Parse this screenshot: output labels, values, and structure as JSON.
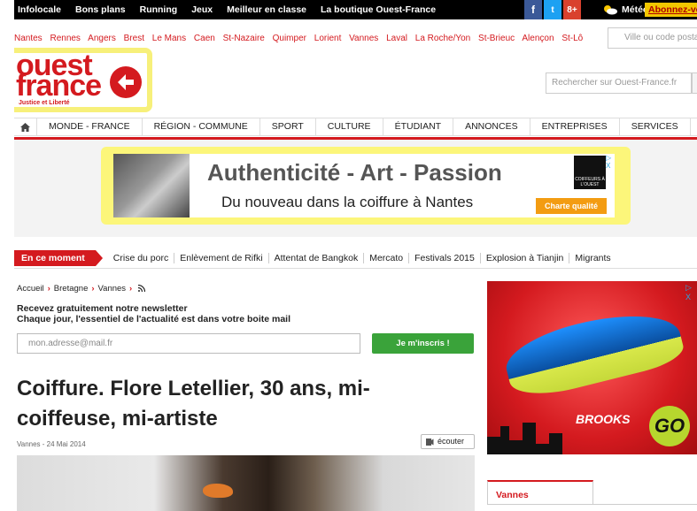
{
  "topbar": {
    "links": [
      "Infolocale",
      "Bons plans",
      "Running",
      "Jeux",
      "Meilleur en classe",
      "La boutique Ouest-France"
    ],
    "social": [
      "f",
      "t",
      "8+"
    ],
    "meteo": "Météo",
    "subscribe": "Abonnez-vous"
  },
  "cities": [
    "Nantes",
    "Rennes",
    "Angers",
    "Brest",
    "Le Mans",
    "Caen",
    "St-Nazaire",
    "Quimper",
    "Lorient",
    "Vannes",
    "Laval",
    "La Roche/Yon",
    "St-Brieuc",
    "Alençon",
    "St-Lô"
  ],
  "city_search_placeholder": "Ville ou code postal",
  "logo": {
    "line1": "ouest",
    "line2": "france",
    "tagline": "Justice et Liberté"
  },
  "site_search_placeholder": "Rechercher sur Ouest-France.fr",
  "nav": [
    "MONDE - FRANCE",
    "RÉGION - COMMUNE",
    "SPORT",
    "CULTURE",
    "ÉTUDIANT",
    "ANNONCES",
    "ENTREPRISES",
    "SERVICES"
  ],
  "ad_banner": {
    "headline": "Authenticité - Art - Passion",
    "subline": "Du nouveau dans la coiffure à Nantes",
    "badge": "COIFFEURS À L'OUEST",
    "button": "Charte qualité",
    "close_label": "▷ X"
  },
  "en_ce_moment": {
    "label": "En ce moment",
    "topics": [
      "Crise du porc",
      "Enlèvement de Rifki",
      "Attentat de Bangkok",
      "Mercato",
      "Festivals 2015",
      "Explosion à Tianjin",
      "Migrants"
    ]
  },
  "breadcrumb": [
    "Accueil",
    "Bretagne",
    "Vannes"
  ],
  "newsletter": {
    "line1": "Recevez gratuitement notre newsletter",
    "line2": "Chaque jour, l'essentiel de l'actualité est dans votre boite mail",
    "placeholder": "mon.adresse@mail.fr",
    "button": "Je m'inscris !"
  },
  "article": {
    "title": "Coiffure. Flore Letellier, 30 ans, mi-coiffeuse, mi-artiste",
    "dateline": "Vannes - 24 Mai 2014",
    "listen_button": "écouter"
  },
  "right_ad": {
    "brand": "BROOKS",
    "go": "GO",
    "close_label": "▷ X"
  },
  "sidebar": {
    "section_tab": "Vannes"
  },
  "colors": {
    "brand_red": "#d41a1f",
    "highlight_yellow": "#f7f07a",
    "cta_green": "#3aa33a"
  }
}
